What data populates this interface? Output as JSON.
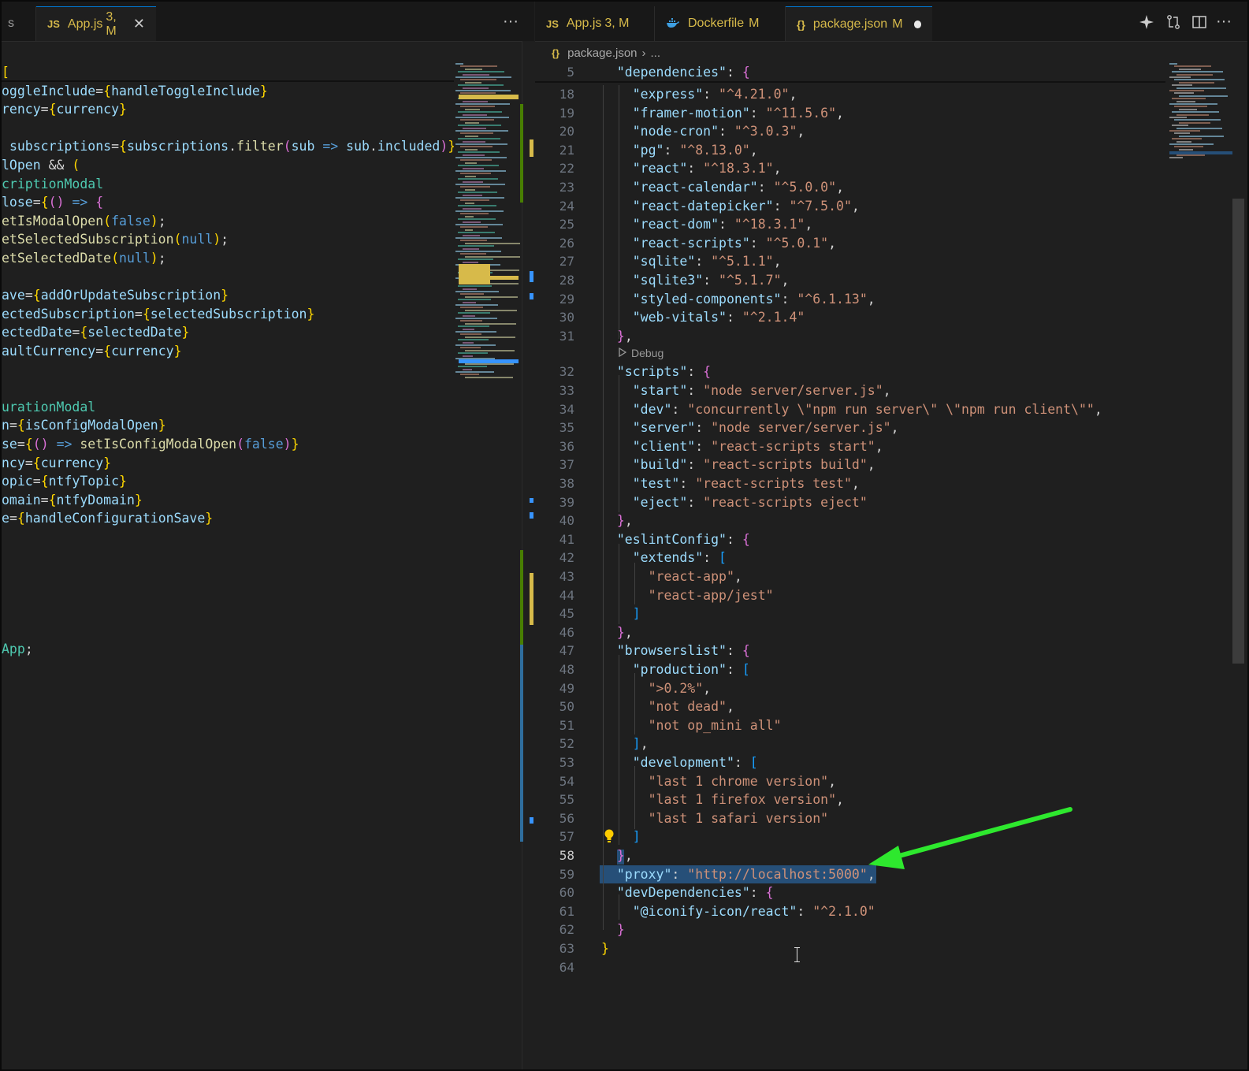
{
  "left_tabs": [
    {
      "partial": "s"
    },
    {
      "icon": "JS",
      "name": "App.js",
      "badge": "3, M",
      "close": "✕"
    }
  ],
  "right_tabs": [
    {
      "icon": "JS",
      "name": "App.js",
      "badge": "3, M"
    },
    {
      "icon": "docker",
      "name": "Dockerfile",
      "badge": "M"
    },
    {
      "icon": "{}",
      "name": "package.json",
      "badge": "M",
      "modified_dot": true
    }
  ],
  "more_actions": "···",
  "breadcrumb": {
    "icon": "{}",
    "file": "package.json",
    "separator": "›",
    "rest": "..."
  },
  "codelens": "Debug",
  "line_numbers": {
    "sticky": "5",
    "lines": [
      "18",
      "19",
      "20",
      "21",
      "22",
      "23",
      "24",
      "25",
      "26",
      "27",
      "28",
      "29",
      "30",
      "31",
      "32",
      "33",
      "34",
      "35",
      "36",
      "37",
      "38",
      "39",
      "40",
      "41",
      "42",
      "43",
      "44",
      "45",
      "46",
      "47",
      "48",
      "49",
      "50",
      "51",
      "52",
      "53",
      "54",
      "55",
      "56",
      "57",
      "58",
      "59",
      "60",
      "61",
      "62",
      "63",
      "64"
    ]
  },
  "json_code": {
    "sticky": "  \"dependencies\": {",
    "lines": [
      "    \"express\": \"^4.21.0\",",
      "    \"framer-motion\": \"^11.5.6\",",
      "    \"node-cron\": \"^3.0.3\",",
      "    \"pg\": \"^8.13.0\",",
      "    \"react\": \"^18.3.1\",",
      "    \"react-calendar\": \"^5.0.0\",",
      "    \"react-datepicker\": \"^7.5.0\",",
      "    \"react-dom\": \"^18.3.1\",",
      "    \"react-scripts\": \"^5.0.1\",",
      "    \"sqlite\": \"^5.1.1\",",
      "    \"sqlite3\": \"^5.1.7\",",
      "    \"styled-components\": \"^6.1.13\",",
      "    \"web-vitals\": \"^2.1.4\"",
      "  },",
      "  \"scripts\": {",
      "    \"start\": \"node server/server.js\",",
      "    \"dev\": \"concurrently \\\"npm run server\\\" \\\"npm run client\\\"\",",
      "    \"server\": \"node server/server.js\",",
      "    \"client\": \"react-scripts start\",",
      "    \"build\": \"react-scripts build\",",
      "    \"test\": \"react-scripts test\",",
      "    \"eject\": \"react-scripts eject\"",
      "  },",
      "  \"eslintConfig\": {",
      "    \"extends\": [",
      "      \"react-app\",",
      "      \"react-app/jest\"",
      "    ]",
      "  },",
      "  \"browserslist\": {",
      "    \"production\": [",
      "      \">0.2%\",",
      "      \"not dead\",",
      "      \"not op_mini all\"",
      "    ],",
      "    \"development\": [",
      "      \"last 1 chrome version\",",
      "      \"last 1 firefox version\",",
      "      \"last 1 safari version\"",
      "    ]",
      "  },",
      "  \"proxy\": \"http://localhost:5000\",",
      "  \"devDependencies\": {",
      "    \"@iconify-icon/react\": \"^2.1.0\"",
      "  }",
      "}",
      ""
    ]
  },
  "app_code": {
    "lines": [
      "[",
      "oggleInclude={handleToggleInclude}",
      "rency={currency}",
      "",
      " subscriptions={subscriptions.filter(sub => sub.included)} cu",
      "lOpen && (",
      "criptionModal",
      "lose={() => {",
      "etIsModalOpen(false);",
      "etSelectedSubscription(null);",
      "etSelectedDate(null);",
      "",
      "ave={addOrUpdateSubscription}",
      "ectedSubscription={selectedSubscription}",
      "ectedDate={selectedDate}",
      "aultCurrency={currency}",
      "",
      "",
      "urationModal",
      "n={isConfigModalOpen}",
      "se={() => setIsConfigModalOpen(false)}",
      "ncy={currency}",
      "opic={ntfyTopic}",
      "omain={ntfyDomain}",
      "e={handleConfigurationSave}",
      "",
      "",
      "",
      "",
      "",
      "",
      "App;"
    ]
  },
  "colors": {
    "editor_bg": "#1f1f1f",
    "tab_bg": "#181818",
    "accent_blue": "#0078d4",
    "modified_yellow": "#d7ba4a",
    "arrow_green": "#2ee82e",
    "selection": "#264f78"
  }
}
